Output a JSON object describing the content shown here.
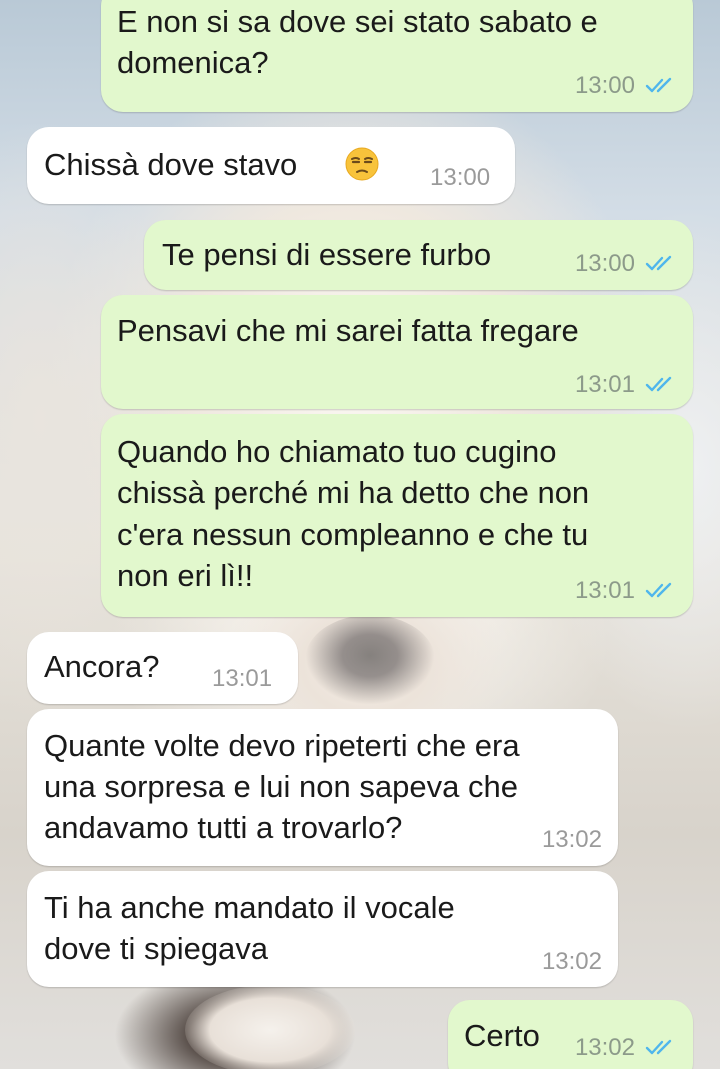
{
  "conversation": {
    "messages": [
      {
        "direction": "outgoing",
        "lines": [
          "E non si sa dove sei stato sabato e",
          "domenica?"
        ],
        "time": "13:00",
        "status": "read"
      },
      {
        "direction": "incoming",
        "lines": [
          "Chissà dove stavo"
        ],
        "emoji": "unamused-face-emoji",
        "time": "13:00"
      },
      {
        "direction": "outgoing",
        "lines": [
          "Te pensi di essere furbo"
        ],
        "time": "13:00",
        "status": "read"
      },
      {
        "direction": "outgoing",
        "lines": [
          "Pensavi che mi sarei fatta fregare"
        ],
        "time": "13:01",
        "status": "read"
      },
      {
        "direction": "outgoing",
        "lines": [
          "Quando ho chiamato tuo cugino",
          "chissà perché mi ha detto che non",
          "c'era nessun compleanno e che tu",
          "non eri lì!!"
        ],
        "time": "13:01",
        "status": "read"
      },
      {
        "direction": "incoming",
        "lines": [
          "Ancora?"
        ],
        "time": "13:01"
      },
      {
        "direction": "incoming",
        "lines": [
          "Quante volte devo ripeterti che era",
          "una sorpresa e lui non sapeva che",
          "andavamo tutti a trovarlo?"
        ],
        "time": "13:02"
      },
      {
        "direction": "incoming",
        "lines": [
          "Ti ha anche mandato il vocale",
          "dove ti spiegava"
        ],
        "time": "13:02"
      },
      {
        "direction": "outgoing",
        "lines": [
          "Certo"
        ],
        "time": "13:02",
        "status": "read"
      }
    ]
  },
  "colors": {
    "outgoing_bubble": "#e2f8cd",
    "incoming_bubble": "#ffffff",
    "read_ticks": "#4fb6ec",
    "timestamp": "#8c9a8a"
  },
  "icons": {
    "read_status": "double-check-icon",
    "emoji": "unamused-face-emoji"
  }
}
